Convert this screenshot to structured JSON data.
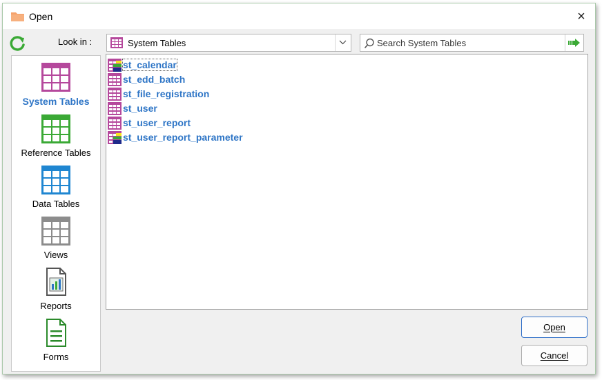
{
  "window": {
    "title": "Open",
    "close_glyph": "×"
  },
  "toolbar": {
    "lookin_label": "Look in :",
    "lookin_value": "System Tables",
    "search_placeholder": "Search System Tables"
  },
  "places": [
    {
      "label": "System Tables",
      "icon": "system-tables-icon",
      "color": "#b5489c",
      "active": true
    },
    {
      "label": "Reference Tables",
      "icon": "reference-tables-icon",
      "color": "#3aa935",
      "active": false
    },
    {
      "label": "Data Tables",
      "icon": "data-tables-icon",
      "color": "#1f86d1",
      "active": false
    },
    {
      "label": "Views",
      "icon": "views-icon",
      "color": "#8c8c8c",
      "active": false
    },
    {
      "label": "Reports",
      "icon": "reports-icon",
      "color": "#555555",
      "active": false
    },
    {
      "label": "Forms",
      "icon": "forms-icon",
      "color": "#2a8a2a",
      "active": false
    }
  ],
  "files": [
    {
      "name": "st_calendar",
      "badge": "multi"
    },
    {
      "name": "st_edd_batch",
      "badge": "none"
    },
    {
      "name": "st_file_registration",
      "badge": "none"
    },
    {
      "name": "st_user",
      "badge": "none"
    },
    {
      "name": "st_user_report",
      "badge": "none"
    },
    {
      "name": "st_user_report_parameter",
      "badge": "multi"
    }
  ],
  "buttons": {
    "open": "Open",
    "cancel": "Cancel"
  },
  "colors": {
    "accent": "#2e75c6",
    "system_table": "#b5489c",
    "go_arrow": "#3aa935"
  }
}
